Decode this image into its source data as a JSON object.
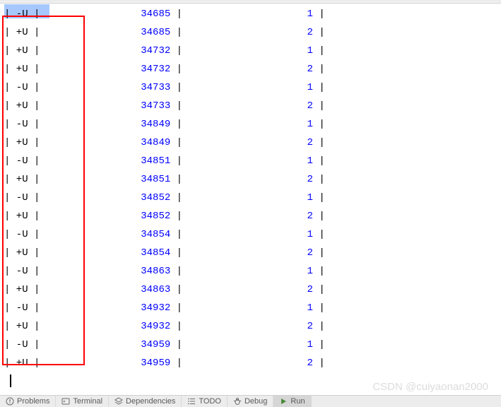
{
  "console": {
    "rows": [
      {
        "u": "-U",
        "val": "34685",
        "count": "1"
      },
      {
        "u": "+U",
        "val": "34685",
        "count": "2"
      },
      {
        "u": "+U",
        "val": "34732",
        "count": "1"
      },
      {
        "u": "+U",
        "val": "34732",
        "count": "2"
      },
      {
        "u": "-U",
        "val": "34733",
        "count": "1"
      },
      {
        "u": "+U",
        "val": "34733",
        "count": "2"
      },
      {
        "u": "-U",
        "val": "34849",
        "count": "1"
      },
      {
        "u": "+U",
        "val": "34849",
        "count": "2"
      },
      {
        "u": "-U",
        "val": "34851",
        "count": "1"
      },
      {
        "u": "+U",
        "val": "34851",
        "count": "2"
      },
      {
        "u": "-U",
        "val": "34852",
        "count": "1"
      },
      {
        "u": "+U",
        "val": "34852",
        "count": "2"
      },
      {
        "u": "-U",
        "val": "34854",
        "count": "1"
      },
      {
        "u": "+U",
        "val": "34854",
        "count": "2"
      },
      {
        "u": "-U",
        "val": "34863",
        "count": "1"
      },
      {
        "u": "+U",
        "val": "34863",
        "count": "2"
      },
      {
        "u": "-U",
        "val": "34932",
        "count": "1"
      },
      {
        "u": "+U",
        "val": "34932",
        "count": "2"
      },
      {
        "u": "-U",
        "val": "34959",
        "count": "1"
      },
      {
        "u": "+U",
        "val": "34959",
        "count": "2"
      }
    ]
  },
  "watermark": "CSDN @cuiyaonan2000",
  "tabs": {
    "problems": "Problems",
    "terminal": "Terminal",
    "dependencies": "Dependencies",
    "todo": "TODO",
    "debug": "Debug",
    "run": "Run"
  }
}
